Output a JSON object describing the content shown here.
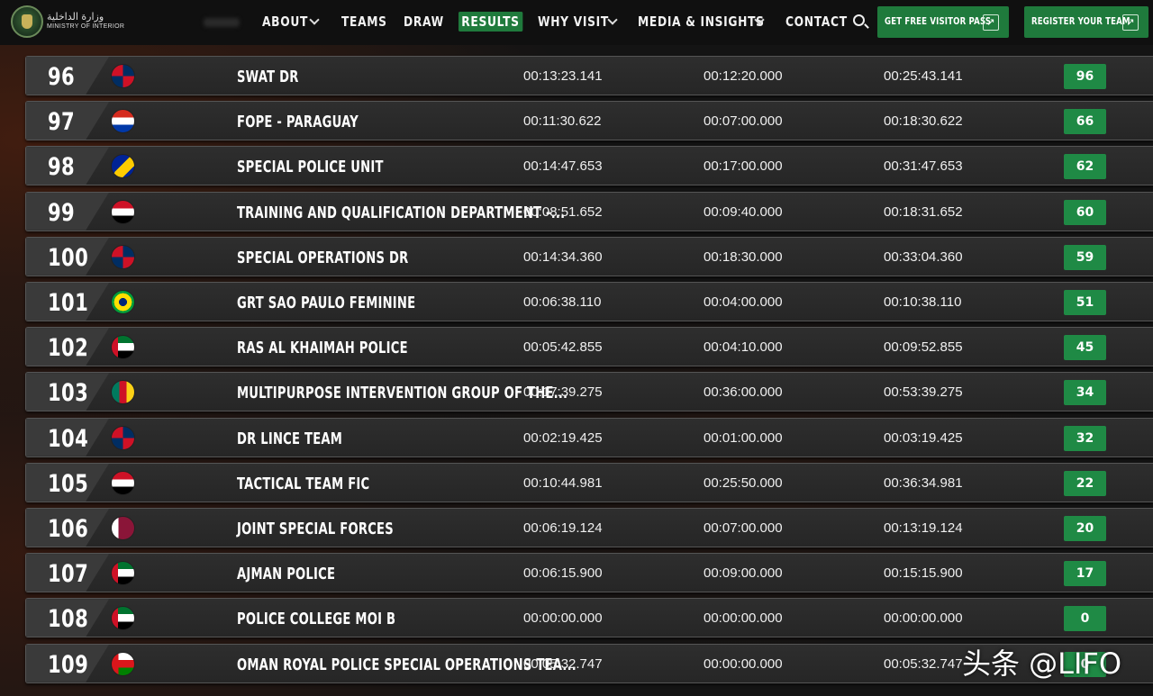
{
  "header": {
    "brand_arabic": "وزارة الداخلية",
    "brand_english": "MINISTRY OF INTERIOR",
    "nav": [
      {
        "label": "ABOUT",
        "dropdown": true
      },
      {
        "label": "TEAMS",
        "dropdown": false
      },
      {
        "label": "DRAW",
        "dropdown": false
      },
      {
        "label": "RESULTS",
        "dropdown": false,
        "active": true
      },
      {
        "label": "WHY VISIT",
        "dropdown": true
      },
      {
        "label": "MEDIA & INSIGHTS",
        "dropdown": true
      },
      {
        "label": "CONTACT",
        "dropdown": false
      }
    ],
    "cta_visitor": "GET FREE VISITOR PASS",
    "cta_register": "REGISTER YOUR TEAM",
    "arrow_glyph": "↗",
    "accent_color": "#1f7a3c"
  },
  "results": [
    {
      "rank": "96",
      "flag": "dominican-republic",
      "team": "SWAT DR",
      "time1": "00:13:23.141",
      "time2": "00:12:20.000",
      "total": "00:25:43.141",
      "score": "96"
    },
    {
      "rank": "97",
      "flag": "paraguay",
      "team": "FOPE - PARAGUAY",
      "time1": "00:11:30.622",
      "time2": "00:07:00.000",
      "total": "00:18:30.622",
      "score": "66"
    },
    {
      "rank": "98",
      "flag": "bosnia",
      "team": "SPECIAL POLICE UNIT",
      "time1": "00:14:47.653",
      "time2": "00:17:00.000",
      "total": "00:31:47.653",
      "score": "62"
    },
    {
      "rank": "99",
      "flag": "syria",
      "team": "TRAINING AND QUALIFICATION DEPARTMENT -...",
      "time1": "00:08:51.652",
      "time2": "00:09:40.000",
      "total": "00:18:31.652",
      "score": "60"
    },
    {
      "rank": "100",
      "flag": "dominican-republic",
      "team": "SPECIAL OPERATIONS DR",
      "time1": "00:14:34.360",
      "time2": "00:18:30.000",
      "total": "00:33:04.360",
      "score": "59"
    },
    {
      "rank": "101",
      "flag": "brazil",
      "team": "GRT SAO PAULO FEMININE",
      "time1": "00:06:38.110",
      "time2": "00:04:00.000",
      "total": "00:10:38.110",
      "score": "51"
    },
    {
      "rank": "102",
      "flag": "uae",
      "team": "RAS AL KHAIMAH POLICE",
      "time1": "00:05:42.855",
      "time2": "00:04:10.000",
      "total": "00:09:52.855",
      "score": "45"
    },
    {
      "rank": "103",
      "flag": "cameroon",
      "team": "MULTIPURPOSE INTERVENTION GROUP OF THE...",
      "time1": "00:17:39.275",
      "time2": "00:36:00.000",
      "total": "00:53:39.275",
      "score": "34"
    },
    {
      "rank": "104",
      "flag": "dominican-republic",
      "team": "DR LINCE TEAM",
      "time1": "00:02:19.425",
      "time2": "00:01:00.000",
      "total": "00:03:19.425",
      "score": "32"
    },
    {
      "rank": "105",
      "flag": "iraq",
      "team": "TACTICAL TEAM FIC",
      "time1": "00:10:44.981",
      "time2": "00:25:50.000",
      "total": "00:36:34.981",
      "score": "22"
    },
    {
      "rank": "106",
      "flag": "qatar",
      "team": "JOINT SPECIAL FORCES",
      "time1": "00:06:19.124",
      "time2": "00:07:00.000",
      "total": "00:13:19.124",
      "score": "20"
    },
    {
      "rank": "107",
      "flag": "uae",
      "team": "AJMAN POLICE",
      "time1": "00:06:15.900",
      "time2": "00:09:00.000",
      "total": "00:15:15.900",
      "score": "17"
    },
    {
      "rank": "108",
      "flag": "uae",
      "team": "POLICE COLLEGE MOI B",
      "time1": "00:00:00.000",
      "time2": "00:00:00.000",
      "total": "00:00:00.000",
      "score": "0"
    },
    {
      "rank": "109",
      "flag": "oman",
      "team": "OMAN ROYAL POLICE SPECIAL OPERATIONS TEA...",
      "time1": "00:05:32.747",
      "time2": "00:00:00.000",
      "total": "00:05:32.747",
      "score": "0"
    }
  ],
  "watermark": "头条 @LIFO"
}
